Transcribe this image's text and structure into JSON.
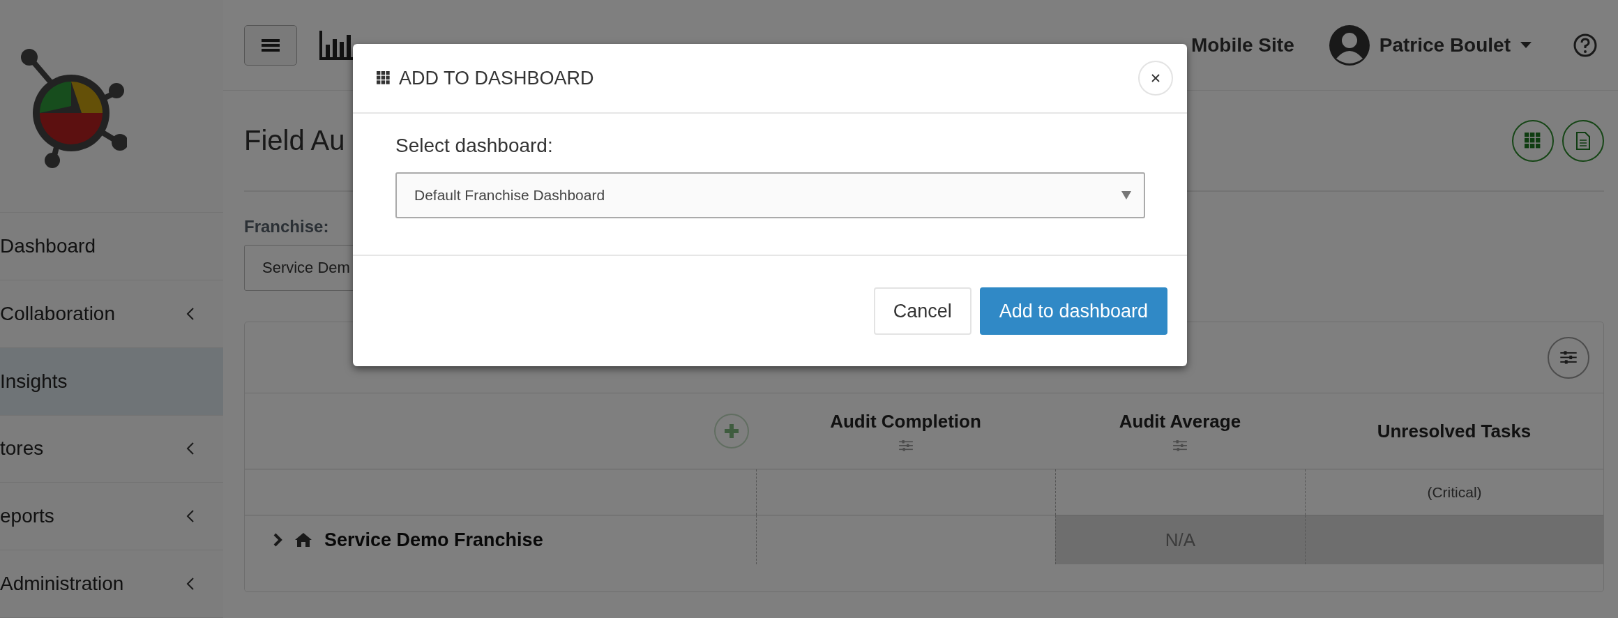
{
  "sidebar": {
    "items": [
      {
        "label": "Dashboard",
        "has_submenu": false,
        "selected": false
      },
      {
        "label": "Collaboration",
        "has_submenu": true,
        "selected": false
      },
      {
        "label": "Insights",
        "has_submenu": false,
        "selected": true
      },
      {
        "label": "tores",
        "has_submenu": true,
        "selected": false
      },
      {
        "label": "eports",
        "has_submenu": true,
        "selected": false
      },
      {
        "label": "Administration",
        "has_submenu": true,
        "selected": false
      }
    ]
  },
  "topbar": {
    "mobile_link": "Mobile Site",
    "user": "Patrice Boulet"
  },
  "page": {
    "title": "Field Au",
    "franchise_label": "Franchise:",
    "franchise_value": "Service Dem"
  },
  "table": {
    "columns": [
      {
        "label": "Audit Completion",
        "has_filter": true
      },
      {
        "label": "Audit Average",
        "has_filter": true
      },
      {
        "label": "Unresolved Tasks",
        "has_filter": false,
        "note": "(Critical)"
      }
    ],
    "rows": [
      {
        "name": "Service Demo Franchise",
        "expanded": false,
        "cells": [
          {
            "shaded": false
          },
          {
            "text": "N/A",
            "shaded": true
          },
          {
            "shaded": true
          }
        ]
      }
    ]
  },
  "modal": {
    "title": "ADD TO DASHBOARD",
    "label": "Select dashboard:",
    "selected_value": "Default Franchise Dashboard",
    "buttons": [
      {
        "label": "Cancel",
        "kind": "secondary"
      },
      {
        "label": "Add to dashboard",
        "kind": "primary"
      }
    ]
  }
}
